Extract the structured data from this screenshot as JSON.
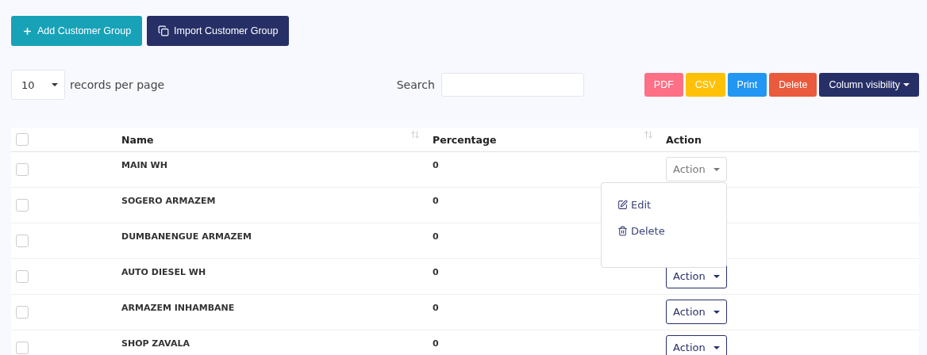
{
  "top_buttons": [
    {
      "label": "Add Customer Group",
      "kind": "add"
    },
    {
      "label": "Import Customer Group",
      "kind": "import"
    }
  ],
  "length_select": {
    "value": "10",
    "label": "records per page"
  },
  "search": {
    "label": "Search"
  },
  "export_buttons": [
    {
      "label": "PDF",
      "color": "#fd7085"
    },
    {
      "label": "CSV",
      "color": "#ffc107"
    },
    {
      "label": "Print",
      "color": "#2196f3"
    },
    {
      "label": "Delete",
      "color": "#ea5a3c"
    },
    {
      "label": "Column visibility",
      "color": "#262f66",
      "caret": true
    }
  ],
  "table": {
    "select_all": {
      "checked": false
    },
    "columns": [
      {
        "label": "Name",
        "sortable": true
      },
      {
        "label": "Percentage",
        "sortable": true
      },
      {
        "label": "Action",
        "sortable": false
      }
    ],
    "rows": [
      {
        "name": "MAIN WH",
        "percentage": "0",
        "checked": false,
        "action": "Action",
        "open": true,
        "menu": [
          {
            "label": "Edit",
            "kind": "edit"
          },
          {
            "label": "Delete",
            "kind": "delete"
          }
        ]
      },
      {
        "name": "SOGERO ARMAZEM",
        "percentage": "0",
        "checked": false,
        "open": false
      },
      {
        "name": "DUMBANENGUE ARMAZEM",
        "percentage": "0",
        "checked": false,
        "open": false
      },
      {
        "name": "AUTO DIESEL WH",
        "percentage": "0",
        "checked": false,
        "action": "Action",
        "open": false
      },
      {
        "name": "ARMAZEM INHAMBANE",
        "percentage": "0",
        "checked": false,
        "action": "Action",
        "open": false
      },
      {
        "name": "SHOP ZAVALA",
        "percentage": "0",
        "checked": false,
        "action": "Action",
        "open": false
      }
    ]
  }
}
